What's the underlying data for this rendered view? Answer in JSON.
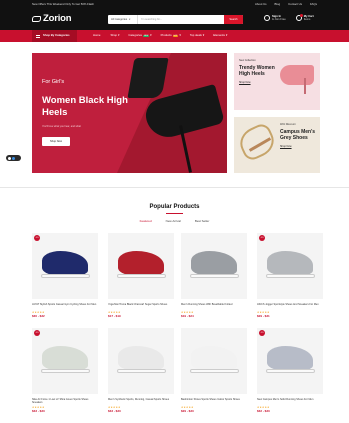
{
  "topbar": {
    "promo": "New Offers This Weekend Only To Get 50% Flash",
    "links": [
      "About Us",
      "Blog",
      "Contact Us",
      "FAQs"
    ]
  },
  "header": {
    "logo": "Zorion",
    "search_category": "All Categories",
    "search_placeholder": "I'm searching for...",
    "search_button": "Search",
    "account_title": "Sign In",
    "account_sub": "& Join Free",
    "cart_title": "My Cart",
    "cart_sub": "Items"
  },
  "nav": {
    "browse": "Shop By Categories",
    "items": [
      {
        "label": "Home",
        "tag": ""
      },
      {
        "label": "Shop",
        "tag": ""
      },
      {
        "label": "Categories",
        "tag": "NEW"
      },
      {
        "label": "Products",
        "tag": "HOT"
      },
      {
        "label": "Top deals",
        "tag": ""
      },
      {
        "label": "Elements",
        "tag": ""
      }
    ]
  },
  "hero": {
    "eyebrow": "For Girl's",
    "title": "Women Black High Heels",
    "subtitle": "You'll love what you hear, and what",
    "button": "Shop Now"
  },
  "side_banners": [
    {
      "eyebrow": "New Collection",
      "title": "Trendy Women High Heels",
      "link": "Shop Now"
    },
    {
      "eyebrow": "40% Discount",
      "title": "Campus Men's Grey Shoes",
      "link": "Shop Now"
    }
  ],
  "section": {
    "title": "Popular Products",
    "tabs": [
      "Featured",
      "New Arrival",
      "Best Seller"
    ],
    "active_tab": "Featured"
  },
  "products": [
    {
      "name": "JAYAT Stylish Sports Casual Gym Cycling Shoes For Men",
      "price": "$30 - $32",
      "badge": "-5%",
      "stars": "★★★★★",
      "color": "#1f2a6b"
    },
    {
      "name": "Yoga Mat 'Puma Black Charcoal' Sugar Sports Shoes",
      "price": "$17 - $19",
      "badge": "",
      "stars": "★★★★★",
      "color": "#b3202c"
    },
    {
      "name": "Men's Running Shoes With Breathable Knitted",
      "price": "$19 - $24",
      "badge": "",
      "stars": "★★★★★",
      "color": "#9a9ea3"
    },
    {
      "name": "ASICS Jogger Sportstyle Shoes And Sneakers For Men",
      "price": "$29 - $31",
      "badge": "-5%",
      "stars": "★★★★★",
      "color": "#b5b8bc"
    },
    {
      "name": "Nike Air Force 1 Low LV 'Mica Green Sports Shoes Sneakers",
      "price": "$33 - $33",
      "badge": "-5%",
      "stars": "★★★★★",
      "color": "#d8ddd6"
    },
    {
      "name": "Men's Synthetic Sports, Running, Casual Sports Shoes",
      "price": "$33 - $33",
      "badge": "",
      "stars": "★★★★★",
      "color": "#e9e9e9"
    },
    {
      "name": "Badminton Shoes Sports Shoes Indoor Sports Shoes",
      "price": "$29 - $33",
      "badge": "",
      "stars": "★★★★★",
      "color": "#f2f2f2"
    },
    {
      "name": "New Campus Men's Solid Running Shoes For Men",
      "price": "$32 - $33",
      "badge": "-5%",
      "stars": "★★★★★",
      "color": "#b7bcc8"
    }
  ],
  "colors": {
    "brand": "#c8102e",
    "dark": "#111111"
  }
}
